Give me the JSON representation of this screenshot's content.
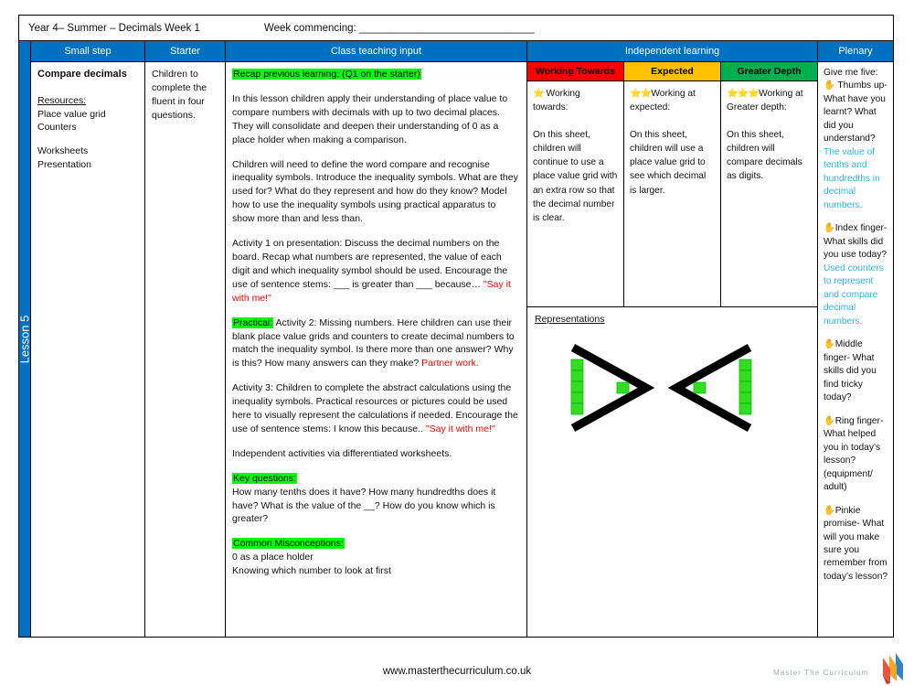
{
  "meta": {
    "title": "Year 4– Summer – Decimals Week 1",
    "week_commencing": "Week commencing: ______________________________"
  },
  "lesson_tab": {
    "label": "Lesson 5"
  },
  "headers": {
    "small_step": "Small step",
    "starter": "Starter",
    "class_teaching_input": "Class teaching input",
    "independent_learning": "Independent learning",
    "plenary": "Plenary"
  },
  "small_step": {
    "title": "Compare decimals",
    "resources_label": "Resources:",
    "resources": [
      "Place value grid",
      "Counters"
    ],
    "extras": [
      "Worksheets",
      "Presentation"
    ]
  },
  "starter": {
    "text": "Children to complete the fluent in four questions."
  },
  "class_teaching_input": {
    "recap_heading": "Recap previous learning: (Q1 on the starter)",
    "para1": "In this lesson children apply their understanding of place value to  compare numbers with decimals with up to two decimal places.     They will consolidate and deepen their understanding of 0 as a      place holder when making a comparison.",
    "para2": "Children will need to define the word compare and recognise inequality symbols. Introduce the inequality symbols. What are they used for? What do they represent and how do they know? Model how to use the inequality symbols using practical apparatus to show more than and less than.",
    "para3": "Activity 1 on presentation: Discuss the decimal numbers on the board. Recap what numbers are represented, the value of each digit and which inequality symbol should be used. Encourage the use of sentence stems: ___ is greater than ___ because… ",
    "para3_red": "\"Say it with me!\"",
    "practical_label": "Practical:",
    "para4": " Activity 2: Missing numbers. Here children can use their blank place value grids and counters to create decimal numbers to match the inequality symbol. Is there more than one answer? Why is this? How many answers can they make? ",
    "para4_red": "Partner work.",
    "para5": "Activity 3: Children to complete the abstract calculations using the inequality symbols. Practical resources or pictures could be used here to visually represent the calculations if needed. Encourage the use of sentence stems: I know this because.. ",
    "para5_red": "\"Say it with me!\"",
    "para6": "Independent activities via differentiated worksheets.",
    "key_questions_label": "Key questions:",
    "key_questions": "How many tenths does it have? How many hundredths does it have? What is the value of the __?  How do you know which is greater?",
    "misconceptions_label": "Common Misconceptions:",
    "misconceptions": [
      "0 as a place holder",
      "Knowing which number to look at first"
    ]
  },
  "independent_learning": {
    "columns": [
      {
        "header": "Working Towards",
        "header_color": "#FF0000",
        "stars": "⭐",
        "lead": " Working towards:",
        "desc": "On this sheet, children will  continue  to use a place value grid with an extra row so that the decimal number is clear."
      },
      {
        "header": "Expected",
        "header_color": "#FFC000",
        "stars": "⭐⭐",
        "lead": "Working at expected:",
        "desc": "On this sheet, children will use a place value grid to see which decimal is larger."
      },
      {
        "header": "Greater Depth",
        "header_color": "#00B050",
        "stars": "⭐⭐⭐",
        "lead": "Working at Greater depth:",
        "desc": "On this sheet, children will compare decimals as digits."
      }
    ],
    "representations_title": "Representations",
    "representation_note": "greater-than and less-than symbols formed with green cube stacks"
  },
  "plenary": {
    "intro": "Give me five:",
    "items": [
      {
        "hand": "✋",
        "question": "Thumbs up- What have you learnt? What did you understand?",
        "answer": "The value of tenths and hundredths in decimal numbers."
      },
      {
        "hand": "✋",
        "question": "Index finger- What skills did you use today?",
        "answer": "Used counters to represent and compare decimal numbers."
      },
      {
        "hand": "✋",
        "question": "Middle finger- What skills did you find tricky today?",
        "answer": ""
      },
      {
        "hand": "✋",
        "question": "Ring finger- What helped you in today’s lesson? (equipment/ adult)",
        "answer": ""
      },
      {
        "hand": "✋",
        "question": "Pinkie promise- What will you make sure you remember from today’s lesson?",
        "answer": ""
      }
    ]
  },
  "footer": {
    "url": "www.masterthecurriculum.co.uk",
    "logo_text": "Master  The  Curriculum"
  },
  "colors": {
    "header_blue": "#0070C0",
    "highlight_green": "#00FF00",
    "red_text": "#FF0000",
    "answer_cyan": "#2FB3E8",
    "working_towards": "#FF0000",
    "expected": "#FFC000",
    "greater_depth": "#00B050",
    "cube_green": "#33DD22"
  }
}
